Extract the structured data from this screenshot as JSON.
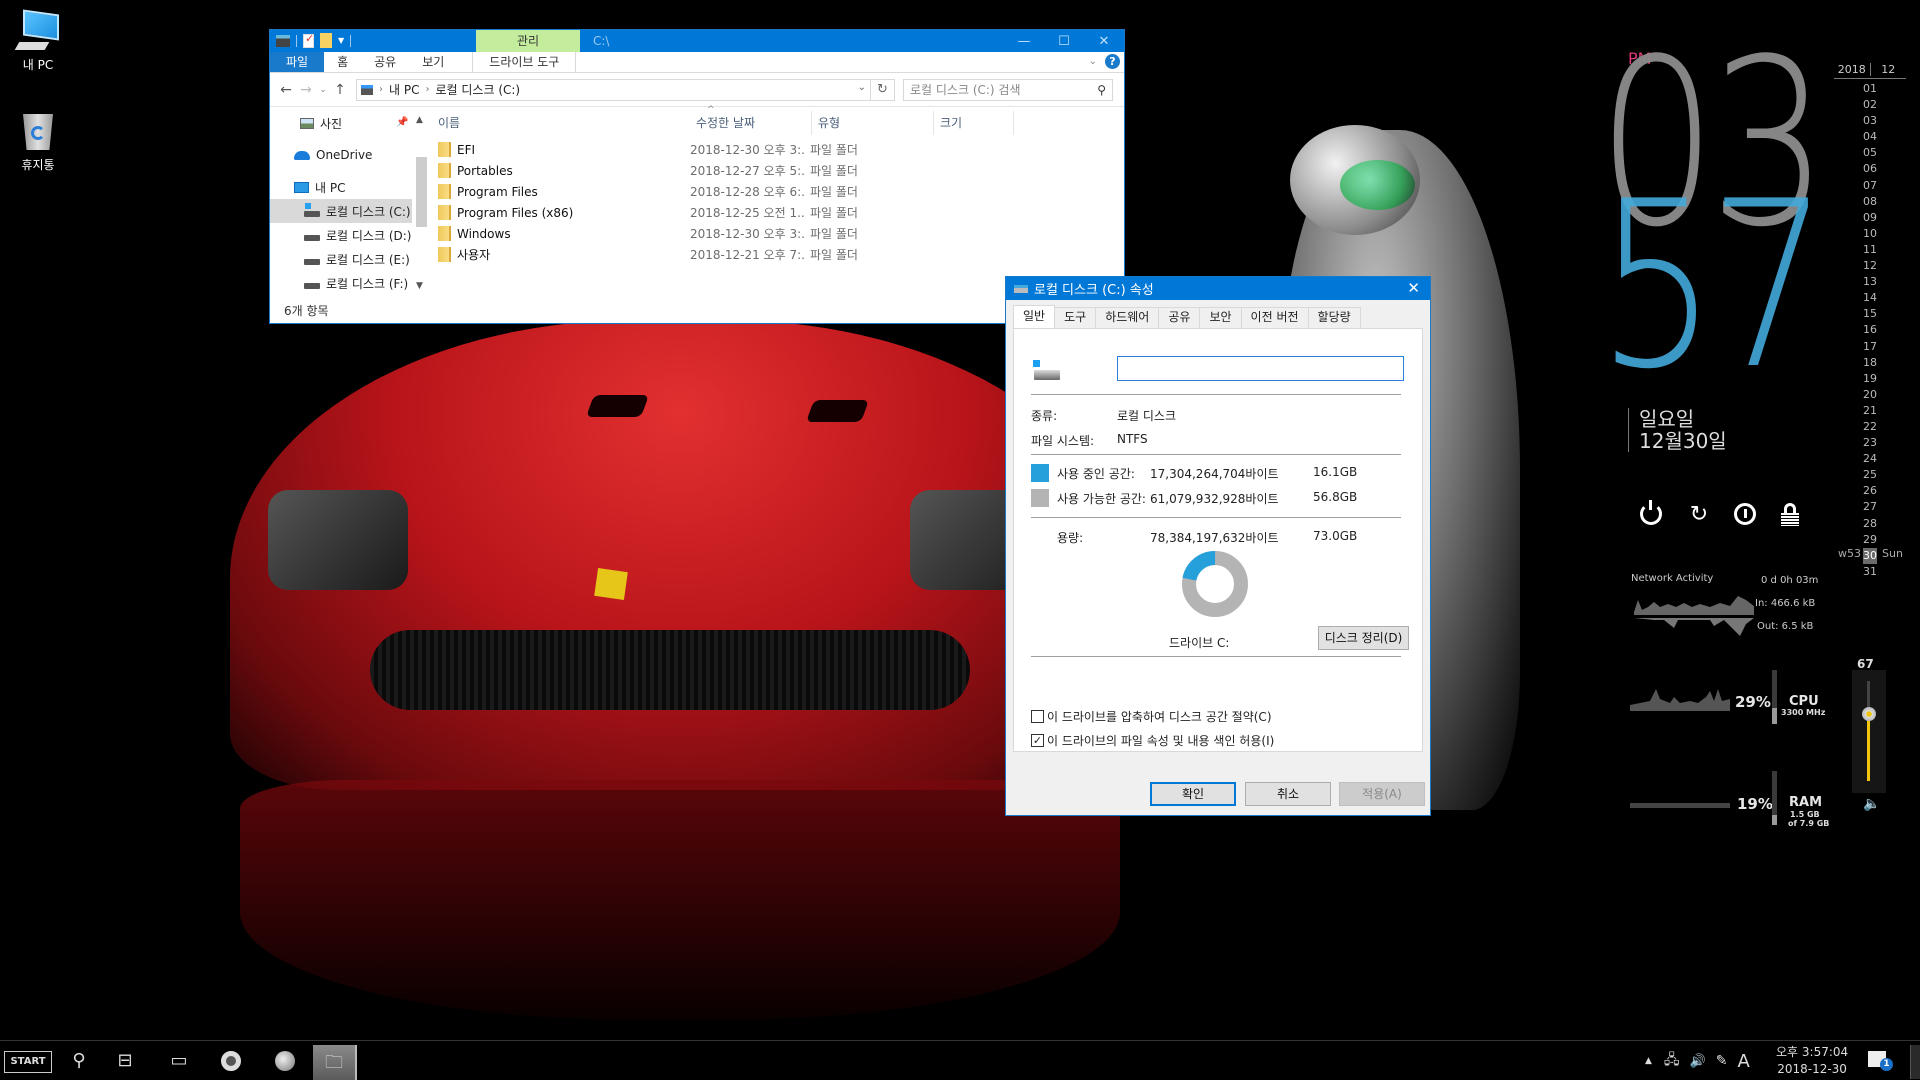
{
  "desktop": {
    "icons": [
      {
        "label": "내 PC",
        "icon": "this-pc-icon"
      },
      {
        "label": "휴지통",
        "icon": "recycle-bin-icon"
      }
    ]
  },
  "explorer": {
    "title_path": "C:\\",
    "context_tab_header": "관리",
    "ribbon_tabs": [
      "파일",
      "홈",
      "공유",
      "보기"
    ],
    "context_tab": "드라이브 도구",
    "window_controls": {
      "minimize": "—",
      "maximize": "☐",
      "close": "✕"
    },
    "help": "?",
    "address": {
      "crumbs": [
        "내 PC",
        "로컬 디스크 (C:)"
      ]
    },
    "search_placeholder": "로컬 디스크 (C:) 검색",
    "nav_pane": [
      {
        "label": "사진",
        "icon": "pictures-icon",
        "pinned": true
      },
      {
        "label": "OneDrive",
        "icon": "onedrive-icon"
      },
      {
        "label": "내 PC",
        "icon": "this-pc-icon"
      },
      {
        "label": "로컬 디스크 (C:)",
        "icon": "system-drive-icon",
        "selected": true
      },
      {
        "label": "로컬 디스크 (D:)",
        "icon": "drive-icon"
      },
      {
        "label": "로컬 디스크 (E:)",
        "icon": "drive-icon"
      },
      {
        "label": "로컬 디스크 (F:)",
        "icon": "drive-icon"
      }
    ],
    "columns": [
      "이름",
      "수정한 날짜",
      "유형",
      "크기"
    ],
    "files": [
      {
        "name": "EFI",
        "modified": "2018-12-30 오후 3:...",
        "type": "파일 폴더"
      },
      {
        "name": "Portables",
        "modified": "2018-12-27 오후 5:...",
        "type": "파일 폴더"
      },
      {
        "name": "Program Files",
        "modified": "2018-12-28 오후 6:...",
        "type": "파일 폴더"
      },
      {
        "name": "Program Files (x86)",
        "modified": "2018-12-25 오전 1...",
        "type": "파일 폴더"
      },
      {
        "name": "Windows",
        "modified": "2018-12-30 오후 3:...",
        "type": "파일 폴더"
      },
      {
        "name": "사용자",
        "modified": "2018-12-21 오후 7:...",
        "type": "파일 폴더"
      }
    ],
    "status": "6개 항목"
  },
  "properties": {
    "title": "로컬 디스크 (C:) 속성",
    "tabs": [
      "일반",
      "도구",
      "하드웨어",
      "공유",
      "보안",
      "이전 버전",
      "할당량"
    ],
    "active_tab": "일반",
    "volume_name": "",
    "type_label": "종류:",
    "type_value": "로컬 디스크",
    "fs_label": "파일 시스템:",
    "fs_value": "NTFS",
    "used_label": "사용 중인 공간:",
    "used_bytes": "17,304,264,704바이트",
    "used_human": "16.1GB",
    "free_label": "사용 가능한 공간:",
    "free_bytes": "61,079,932,928바이트",
    "free_human": "56.8GB",
    "capacity_label": "용량:",
    "capacity_bytes": "78,384,197,632바이트",
    "capacity_human": "73.0GB",
    "used_fraction": 0.22,
    "used_color": "#26a0da",
    "free_color": "#b4b4b4",
    "drive_label": "드라이브 C:",
    "cleanup_button": "디스크 정리(D)",
    "compress_label": "이 드라이브를 압축하여 디스크 공간 절약(C)",
    "compress_checked": false,
    "index_label": "이 드라이브의 파일 속성 및 내용 색인 허용(I)",
    "index_checked": true,
    "ok": "확인",
    "cancel": "취소",
    "apply": "적용(A)"
  },
  "clock": {
    "ampm": "PM",
    "hours": "03",
    "minutes": "57",
    "weekday": "일요일",
    "date": "12월30일"
  },
  "calendar": {
    "year": "2018",
    "month": "12",
    "days": [
      "01",
      "02",
      "03",
      "04",
      "05",
      "06",
      "07",
      "08",
      "09",
      "10",
      "11",
      "12",
      "13",
      "14",
      "15",
      "16",
      "17",
      "18",
      "19",
      "20",
      "21",
      "22",
      "23",
      "24",
      "25",
      "26",
      "27",
      "28",
      "29",
      "30",
      "31"
    ],
    "today": "30",
    "week": "w53",
    "weekday_short": "Sun"
  },
  "power": [
    "power-icon",
    "restart-icon",
    "shutdown-icon",
    "lock-icon"
  ],
  "network": {
    "title": "Network Activity",
    "uptime": "0 d 0h 03m",
    "in": "In: 466.6 kB",
    "out": "Out: 6.5 kB"
  },
  "cpu": {
    "percent": "29%",
    "value": 29,
    "label": "CPU",
    "freq": "3300 MHz"
  },
  "ram": {
    "percent": "19%",
    "value": 19,
    "label": "RAM",
    "used": "1.5 GB",
    "total": "of 7.9 GB"
  },
  "volume": {
    "value": 67,
    "label": "67"
  },
  "taskbar": {
    "start": "START",
    "apps": [
      "search-icon",
      "task-view-icon",
      "tablet-icon",
      "chrome-icon",
      "browser-globe-icon",
      "file-explorer-icon"
    ],
    "tray_time": "오후 3:57:04",
    "tray_date": "2018-12-30",
    "ime": "A",
    "notifications": "1"
  }
}
